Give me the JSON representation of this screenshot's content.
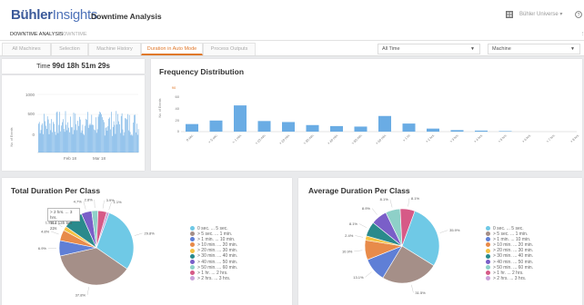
{
  "header": {
    "logo_bold": "Bühler",
    "logo_thin": "Insights",
    "title": "Downtime Analysis",
    "user": "Bühler Universe"
  },
  "subnav": {
    "item1": "DOWNTIME ANALYSIS",
    "item2": "DOWNTIME"
  },
  "tabs": [
    "All Machines",
    "Selection",
    "Machine History",
    "Duration in Auto Mode",
    "Process Outputs"
  ],
  "filters": {
    "time": "All Time",
    "machine": "Machine"
  },
  "total_time": {
    "label": "Time",
    "value": "99d 18h 51m 29s"
  },
  "mini_chart": {
    "yticks": [
      "1000",
      "500",
      "0"
    ],
    "ylabel": "No. of Events",
    "xticks": [
      "Feb 18",
      "Mar 18"
    ]
  },
  "colors": {
    "accent": "#e0782b",
    "bar": "#6aace4",
    "brand": "#3b5a9a"
  },
  "freq": {
    "title": "Frequency Distribution",
    "ylabel": "No. of Events",
    "yticks": [
      "60",
      "40",
      "20",
      "0"
    ],
    "top_value": "90",
    "chart_data": {
      "type": "bar",
      "categories": [
        "0 sec.",
        "> 5 sec.",
        "> 1 min.",
        "> 10 min.",
        "> 20 min.",
        "> 30 min.",
        "> 40 min.",
        "> 50 min.",
        "> 60 min.",
        "> 1 hr.",
        "> 2 hrs.",
        "> 3 hrs.",
        "> 4 hrs.",
        "> 5 hrs.",
        "> 6 hrs.",
        "> 7 hrs.",
        "> 8 hrs."
      ],
      "values": [
        15,
        22,
        52,
        21,
        19,
        13,
        11,
        10,
        31,
        16,
        6,
        3,
        2,
        1,
        0,
        0,
        0
      ],
      "ylim": [
        0,
        90
      ]
    }
  },
  "total_pie": {
    "title": "Total Duration Per Class",
    "tooltip": [
      "> 2 hrs. ... 3 hrs.",
      "11d 13h 5m 22s"
    ],
    "chart_data": {
      "type": "pie",
      "labels": [
        "0 sec. ... 5 sec.",
        "> 5 sec. ... 1 min.",
        "> 1 min. ... 10 min.",
        "> 10 min. ... 20 min.",
        "> 20 min. ... 30 min.",
        "> 30 min. ... 40 min.",
        "> 40 min. ... 50 min.",
        "> 50 min. ... 60 min.",
        "> 1 hr. ... 2 hrs.",
        "> 2 hrs. ... 3 hrs."
      ],
      "values": [
        29.8,
        37.8,
        6.9,
        4.8,
        1.9,
        8.9,
        4.7,
        2.8,
        3.9,
        1.1
      ],
      "slice_labels": [
        "29.8%",
        "37.8%",
        "6.9%",
        "4.8%",
        "1.9%",
        "8.9%",
        "4.7%",
        "2.8%",
        "3.9%",
        "1.1%"
      ]
    }
  },
  "avg_pie": {
    "title": "Average Duration Per Class",
    "chart_data": {
      "type": "pie",
      "labels": [
        "0 sec. ... 5 sec.",
        "> 5 sec. ... 1 min.",
        "> 1 min. ... 10 min.",
        "> 10 min. ... 20 min.",
        "> 20 min. ... 30 min.",
        "> 30 min. ... 40 min.",
        "> 40 min. ... 50 min.",
        "> 50 min. ... 60 min.",
        "> 1 hr. ... 2 hrs.",
        "> 2 hrs. ... 3 hrs."
      ],
      "values": [
        35.9,
        31.5,
        13.1,
        10.9,
        2.4,
        8.1,
        8.9,
        8.1,
        8.1,
        0
      ],
      "slice_labels": [
        "35.9%",
        "31.5%",
        "13.1%",
        "10.9%",
        "2.4%",
        "8.1%",
        "8.9%",
        "8.1%",
        "8.1%",
        ""
      ]
    }
  },
  "pie_colors": [
    "#6fc9e6",
    "#a58f88",
    "#5f7fd6",
    "#e88b4a",
    "#f5c242",
    "#2a8a8c",
    "#7a5fc8",
    "#8ed0c8",
    "#d65a87",
    "#c9a0d8"
  ]
}
